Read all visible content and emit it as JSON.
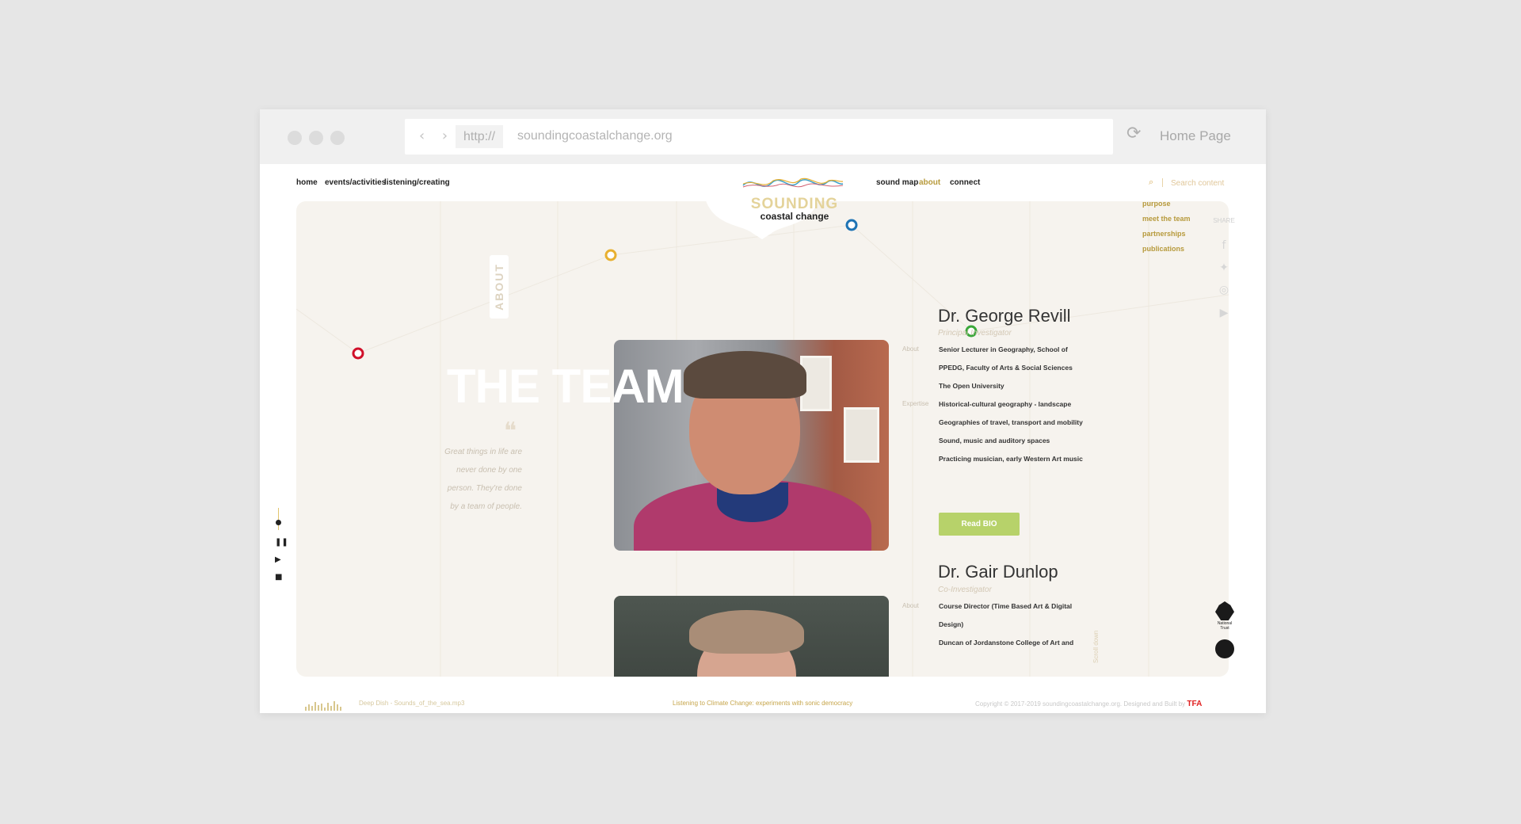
{
  "browser": {
    "protocol": "http://",
    "url": "soundingcoastalchange.org",
    "home_label": "Home Page"
  },
  "nav": {
    "left": [
      "home",
      "events/activities",
      "listening/creating"
    ],
    "right": [
      "sound map",
      "about",
      "connect"
    ],
    "search_placeholder": "Search content",
    "dropdown": [
      "purpose",
      "meet the team",
      "partnerships",
      "publications"
    ]
  },
  "logo": {
    "small": "SOUNDING",
    "main": "coastal change"
  },
  "section_tab": "ABOUT",
  "hero": {
    "title": "THE TEAM",
    "quote": "Great things in life are never done by one person. They're done by a team of people."
  },
  "members": [
    {
      "name": "Dr. George Revill",
      "role": "Principal Investigator",
      "about_label": "About",
      "about": [
        "Senior Lecturer in Geography, School of",
        "PPEDG, Faculty of Arts & Social Sciences",
        "The Open University"
      ],
      "expertise_label": "Expertise",
      "expertise": [
        "Historical-cultural geography - landscape",
        "Geographies of travel, transport and mobility",
        "Sound, music and auditory spaces",
        "Practicing musician, early Western Art music"
      ],
      "button": "Read BIO"
    },
    {
      "name": "Dr. Gair Dunlop",
      "role": "Co-Investigator",
      "about_label": "About",
      "about": [
        "Course Director (Time Based Art & Digital",
        "Design)",
        "Duncan of Jordanstone College of Art and"
      ]
    }
  ],
  "scroll_label": "Scroll down",
  "share": {
    "label": "SHARE",
    "icons": [
      "facebook-icon",
      "twitter-icon",
      "instagram-icon",
      "youtube-icon"
    ]
  },
  "partners": [
    "National Trust"
  ],
  "footer": {
    "track": "Deep Dish - Sounds_of_the_sea.mp3",
    "tagline": "Listening to Climate Change: experiments with sonic democracy",
    "copyright": "Copyright © 2017-2019 soundingcoastalchange.org. Designed and Built by",
    "builder": "TFA"
  },
  "colors": {
    "accent": "#b79a3c",
    "button": "#b7d26a",
    "node_red": "#d0102a",
    "node_yellow": "#e8b030",
    "node_blue": "#1e73b4",
    "node_green": "#3aa83a"
  }
}
